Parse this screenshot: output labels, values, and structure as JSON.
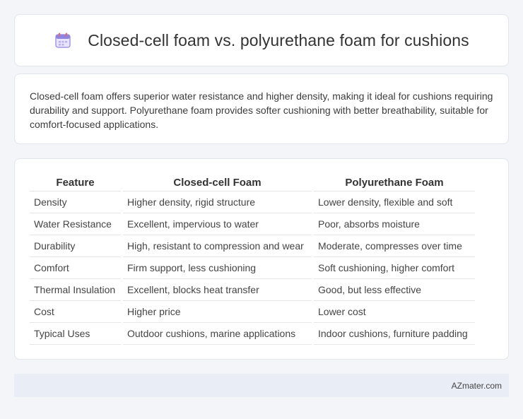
{
  "header": {
    "title": "Closed-cell foam vs. polyurethane foam for cushions",
    "icon": "calendar-icon"
  },
  "summary": {
    "text": "Closed-cell foam offers superior water resistance and higher density, making it ideal for cushions requiring durability and support. Polyurethane foam provides softer cushioning with better breathability, suitable for comfort-focused applications."
  },
  "table": {
    "headers": [
      "Feature",
      "Closed-cell Foam",
      "Polyurethane Foam"
    ],
    "rows": [
      [
        "Density",
        "Higher density, rigid structure",
        "Lower density, flexible and soft"
      ],
      [
        "Water Resistance",
        "Excellent, impervious to water",
        "Poor, absorbs moisture"
      ],
      [
        "Durability",
        "High, resistant to compression and wear",
        "Moderate, compresses over time"
      ],
      [
        "Comfort",
        "Firm support, less cushioning",
        "Soft cushioning, higher comfort"
      ],
      [
        "Thermal Insulation",
        "Excellent, blocks heat transfer",
        "Good, but less effective"
      ],
      [
        "Cost",
        "Higher price",
        "Lower cost"
      ],
      [
        "Typical Uses",
        "Outdoor cushions, marine applications",
        "Indoor cushions, furniture padding"
      ]
    ]
  },
  "footer": {
    "brand": "AZmater.com"
  },
  "colors": {
    "background": "#f3f5f9",
    "card": "#ffffff",
    "footer": "#e9edf6",
    "icon_accent": "#7b6fd6"
  }
}
